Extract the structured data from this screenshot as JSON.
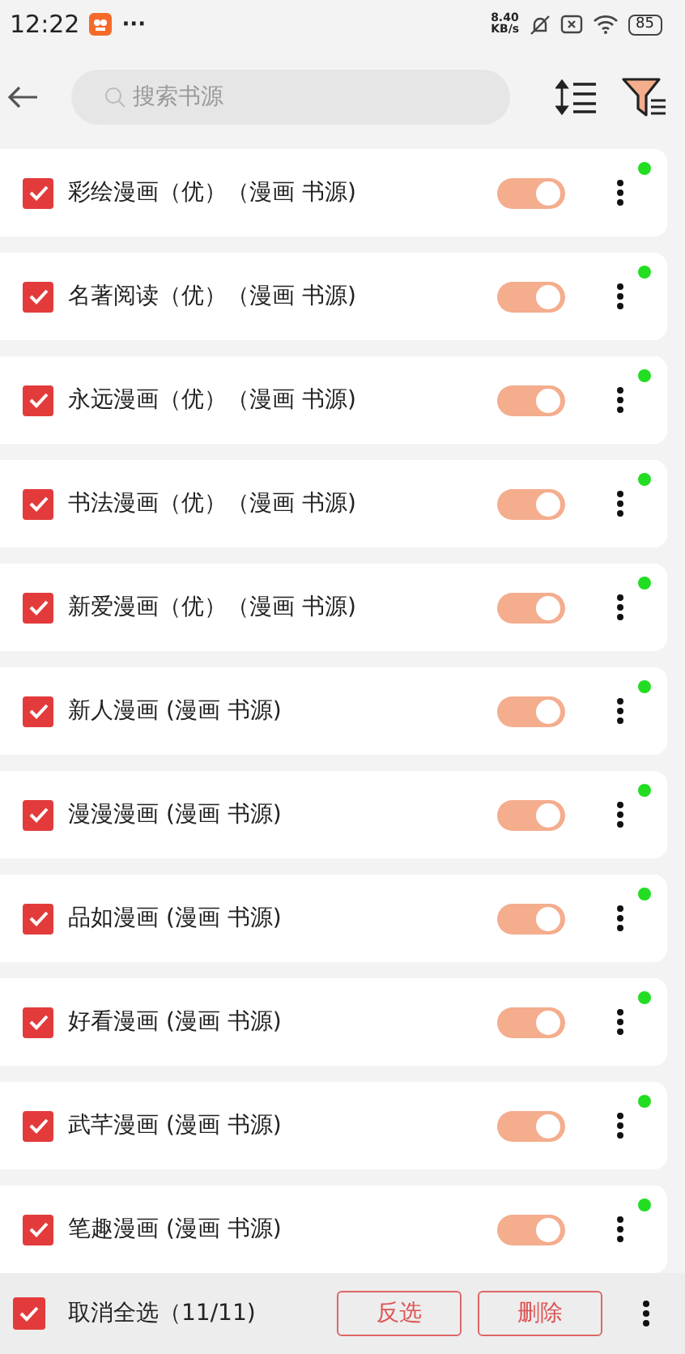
{
  "status_bar": {
    "time": "12:22",
    "more": "···",
    "speed_value": "8.40",
    "speed_unit": "KB/s",
    "battery": "85"
  },
  "search": {
    "placeholder": "搜索书源"
  },
  "sources": [
    {
      "name": "彩绘漫画（优）（漫画 书源)",
      "checked": true,
      "on": true
    },
    {
      "name": "名著阅读（优）（漫画 书源)",
      "checked": true,
      "on": true
    },
    {
      "name": "永远漫画（优）（漫画 书源)",
      "checked": true,
      "on": true
    },
    {
      "name": "书法漫画（优）（漫画 书源)",
      "checked": true,
      "on": true
    },
    {
      "name": "新爱漫画（优）（漫画 书源)",
      "checked": true,
      "on": true
    },
    {
      "name": "新人漫画 (漫画 书源)",
      "checked": true,
      "on": true
    },
    {
      "name": "漫漫漫画 (漫画 书源)",
      "checked": true,
      "on": true
    },
    {
      "name": "品如漫画 (漫画 书源)",
      "checked": true,
      "on": true
    },
    {
      "name": "好看漫画 (漫画 书源)",
      "checked": true,
      "on": true
    },
    {
      "name": "武芊漫画 (漫画 书源)",
      "checked": true,
      "on": true
    },
    {
      "name": "笔趣漫画 (漫画 书源)",
      "checked": true,
      "on": true
    }
  ],
  "bottom_bar": {
    "select_all_checked": true,
    "select_all_label": "取消全选（11/11)",
    "buttons": [
      "反选",
      "删除"
    ]
  }
}
